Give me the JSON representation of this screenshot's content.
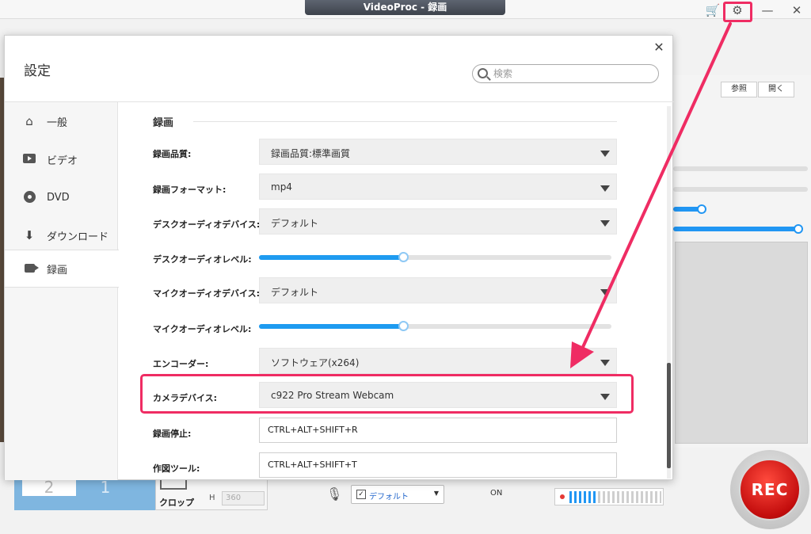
{
  "window": {
    "title": "VideoProc - 録画",
    "icons": [
      "cart-icon",
      "gear-icon",
      "minimize-icon",
      "close-icon"
    ]
  },
  "background": {
    "browse_label": "参照",
    "open_label": "開く",
    "layout_2": "2",
    "layout_1": "1",
    "crop_label": "クロップ",
    "height_label": "H",
    "height_value": "360",
    "mic_device": "デフォルト",
    "on_label": "ON",
    "rec_label": "REC"
  },
  "dialog": {
    "title": "設定",
    "search_placeholder": "検索",
    "nav": [
      {
        "label": "一般",
        "icon": "home-icon"
      },
      {
        "label": "ビデオ",
        "icon": "video-icon"
      },
      {
        "label": "DVD",
        "icon": "dvd-icon"
      },
      {
        "label": "ダウンロード",
        "icon": "download-icon"
      },
      {
        "label": "録画",
        "icon": "camera-icon",
        "active": true
      }
    ],
    "section_title": "録画",
    "rows": {
      "quality": {
        "label": "録画品質:",
        "value": "録画品質:標準画質"
      },
      "format": {
        "label": "録画フォーマット:",
        "value": "mp4"
      },
      "desktop_audio_device": {
        "label": "デスクオーディオデバイス:",
        "value": "デフォルト"
      },
      "desktop_audio_level": {
        "label": "デスクオーディオレベル:",
        "value": 0.41
      },
      "mic_audio_device": {
        "label": "マイクオーディオデバイス:",
        "value": "デフォルト"
      },
      "mic_audio_level": {
        "label": "マイクオーディオレベル:",
        "value": 0.41
      },
      "encoder": {
        "label": "エンコーダー:",
        "value": "ソフトウェア(x264)"
      },
      "camera_device": {
        "label": "カメラデバイス:",
        "value": "c922 Pro Stream Webcam"
      },
      "stop_hotkey": {
        "label": "録画停止:",
        "value": "CTRL+ALT+SHIFT+R"
      },
      "drawing_hotkey": {
        "label": "作図ツール:",
        "value": "CTRL+ALT+SHIFT+T"
      }
    }
  },
  "colors": {
    "highlight": "#ef2c63",
    "accent": "#1e9bf0",
    "rec": "#d81a1a"
  }
}
